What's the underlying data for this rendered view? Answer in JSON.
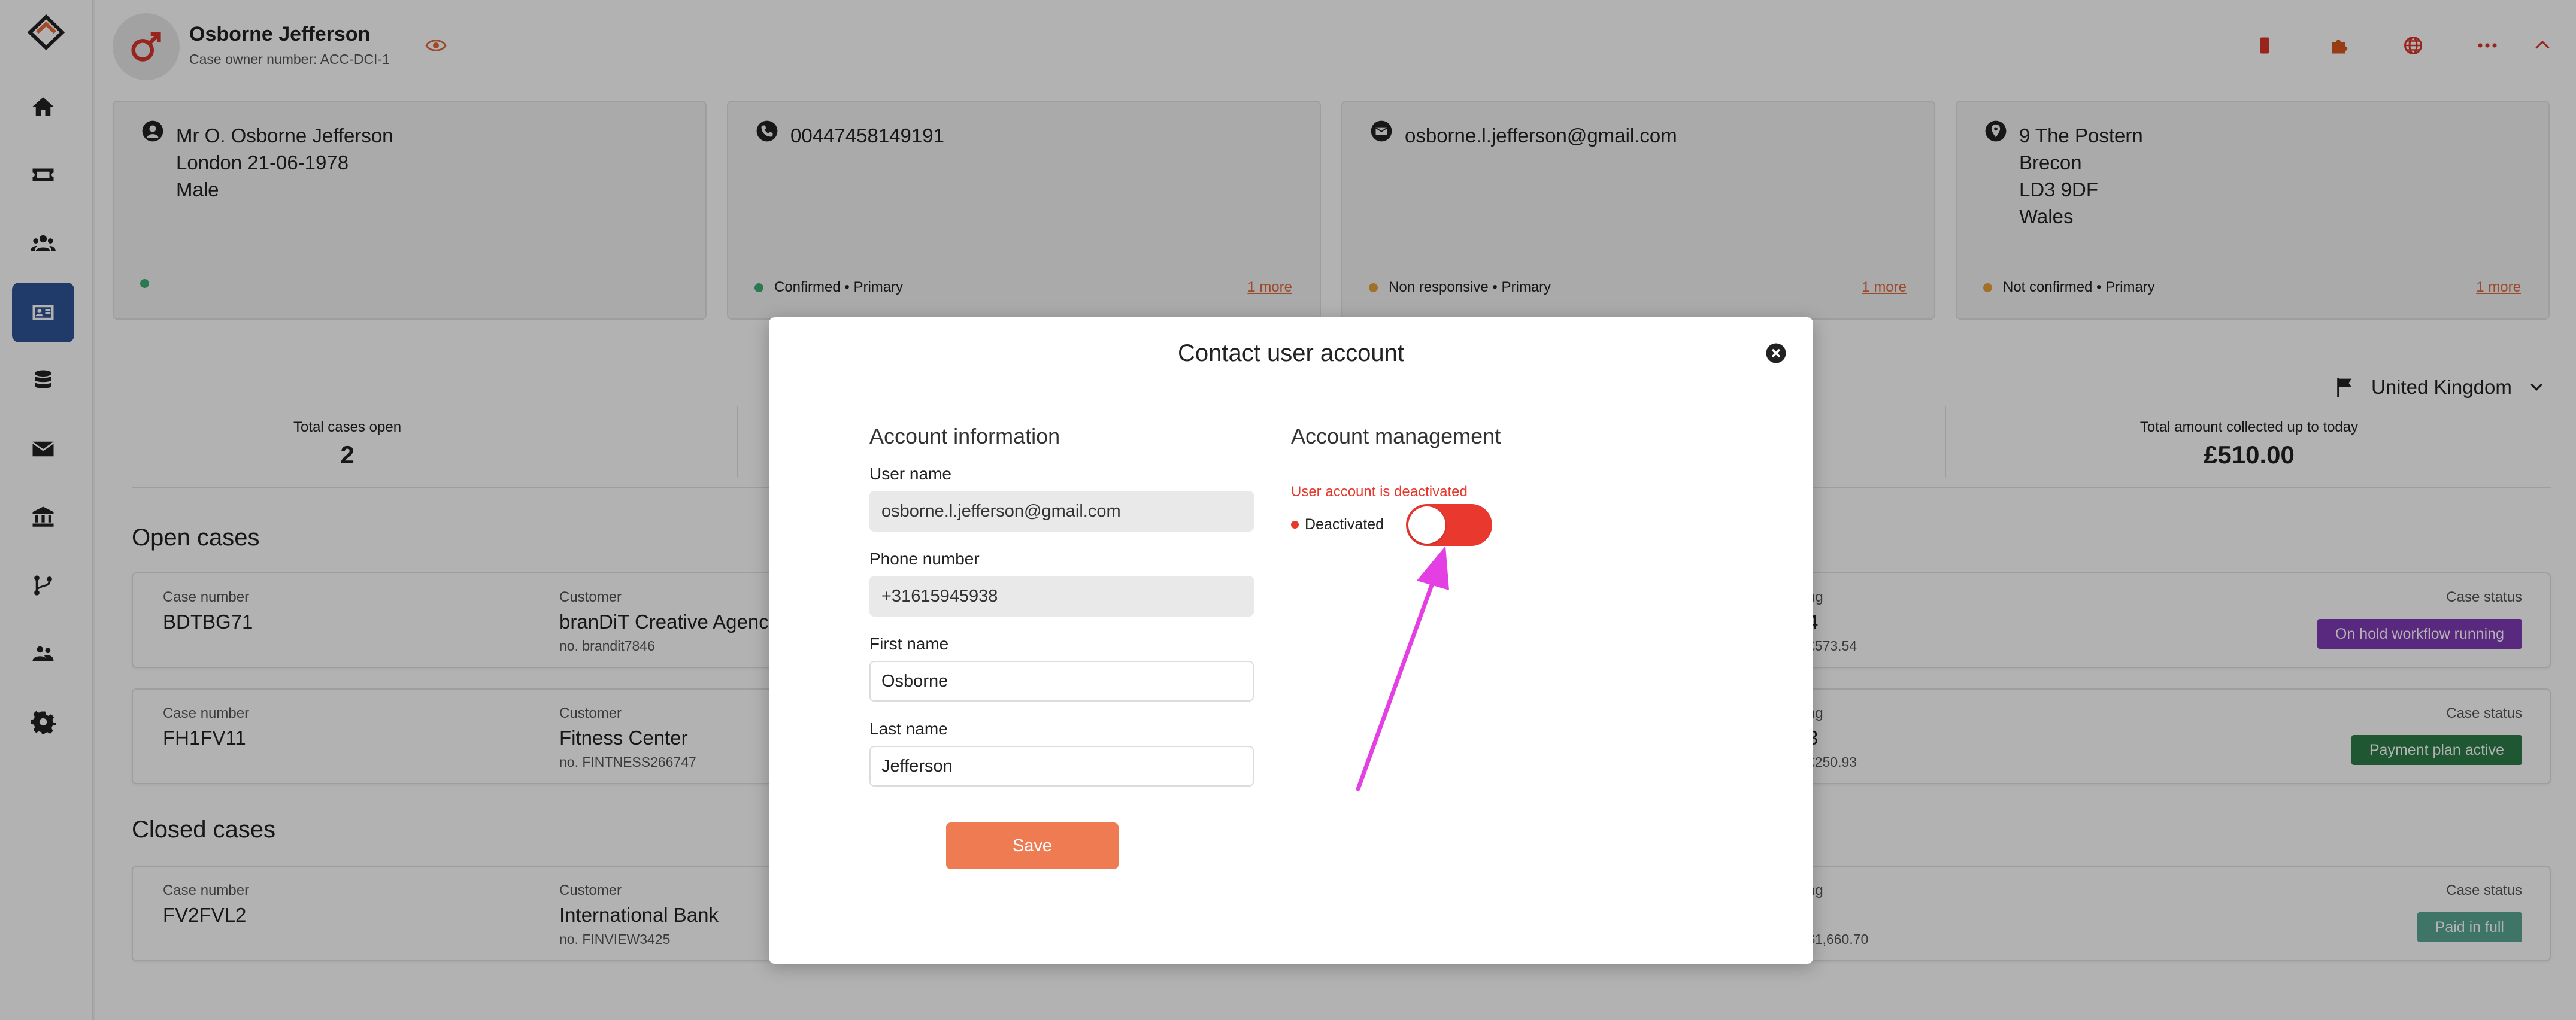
{
  "header": {
    "person_name": "Osborne Jefferson",
    "owner_number": "Case owner number: ACC-DCI-1",
    "icons": [
      "male-gender-icon",
      "eye-icon",
      "mobile-icon",
      "puzzle-icon",
      "globe-icon",
      "more-icon",
      "chevron-up-icon"
    ]
  },
  "sidebar": {
    "items": [
      {
        "name": "home-icon"
      },
      {
        "name": "ticket-icon"
      },
      {
        "name": "users-icon"
      },
      {
        "name": "contact-card-icon",
        "active": true
      },
      {
        "name": "database-icon"
      },
      {
        "name": "mail-icon"
      },
      {
        "name": "bank-icon"
      },
      {
        "name": "workflow-icon"
      },
      {
        "name": "team-icon"
      },
      {
        "name": "settings-icon"
      }
    ]
  },
  "info_cards": [
    {
      "icon": "person-icon",
      "lines": [
        "Mr O. Osborne Jefferson",
        "London 21-06-1978",
        "Male"
      ],
      "status": "",
      "more": ""
    },
    {
      "icon": "phone-icon",
      "lines": [
        "00447458149191"
      ],
      "status": "Confirmed • Primary",
      "more": "1 more"
    },
    {
      "icon": "email-icon",
      "lines": [
        "osborne.l.jefferson@gmail.com"
      ],
      "status": "Non responsive • Primary",
      "more": "1 more"
    },
    {
      "icon": "location-icon",
      "lines": [
        "9 The Postern",
        "Brecon",
        "LD3 9DF",
        "Wales"
      ],
      "status": "Not confirmed • Primary",
      "more": "1 more"
    }
  ],
  "country": "United Kingdom",
  "stats": [
    {
      "label": "Total cases open",
      "value": "2"
    },
    {
      "label": "Total amount collected up to today",
      "value": "£510.00"
    }
  ],
  "sections": {
    "open": "Open cases",
    "closed": "Closed cases"
  },
  "cases": [
    {
      "case_label": "Case number",
      "case_number": "BDTBG71",
      "customer_label": "Customer",
      "customer": "branDiT Creative Agency",
      "customer_no": "no.  brandit7846",
      "col3_label": "ng",
      "col3_value": "4",
      "col3_sub": "£573.54",
      "status_label": "Case status",
      "status": "On hold workflow running"
    },
    {
      "case_label": "Case number",
      "case_number": "FH1FV11",
      "customer_label": "Customer",
      "customer": "Fitness Center",
      "customer_no": "no.  FINTNESS266747",
      "col3_label": "ng",
      "col3_value": "3",
      "col3_sub": "£250.93",
      "status_label": "Case status",
      "status": "Payment plan active"
    },
    {
      "case_label": "Case number",
      "case_number": "FV2FVL2",
      "customer_label": "Customer",
      "customer": "International Bank",
      "customer_no": "no.  FINVIEW3425",
      "col3_label": "ng",
      "col3_value": "",
      "col3_sub": "$1,660.70",
      "status_label": "Case status",
      "status": "Paid in full"
    }
  ],
  "modal": {
    "title": "Contact user account",
    "account_info_title": "Account information",
    "account_mgmt_title": "Account management",
    "fields": {
      "username": {
        "label": "User name",
        "value": "osborne.l.jefferson@gmail.com"
      },
      "phone": {
        "label": "Phone number",
        "value": "+31615945938"
      },
      "first_name": {
        "label": "First name",
        "value": "Osborne"
      },
      "last_name": {
        "label": "Last name",
        "value": "Jefferson"
      }
    },
    "deactivated_message": "User account is deactivated",
    "deactivated_label": "Deactivated",
    "toggle_on": false,
    "save_label": "Save"
  },
  "colors": {
    "accent": "#ef7b52",
    "nav_active": "#2f5597",
    "danger": "#e9392e",
    "status_green": "#3fae74",
    "status_orange": "#e8a23a",
    "badge_purple": "#7e3bb5",
    "badge_green": "#2e7d4a",
    "badge_teal": "#5aa892",
    "annotation_arrow": "#e33fe3"
  }
}
